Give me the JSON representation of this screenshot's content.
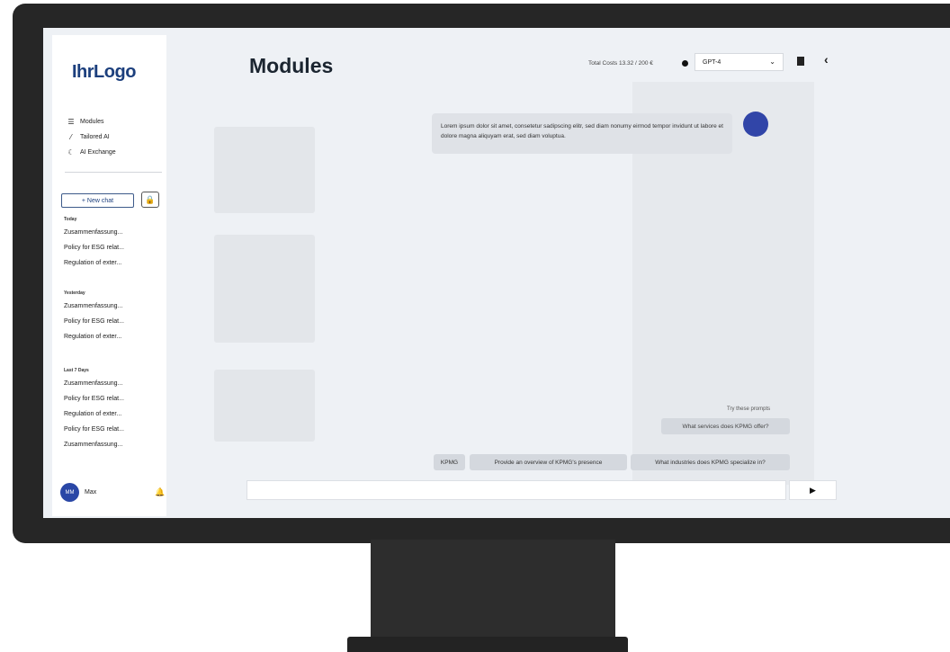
{
  "app": {
    "logo": "IhrLogo",
    "page_title": "Modules"
  },
  "nav": [
    {
      "label": "Modules",
      "icon": "grid-icon"
    },
    {
      "label": "Tailored AI",
      "icon": "wand-icon"
    },
    {
      "label": "AI Exchange",
      "icon": "crescent-icon"
    }
  ],
  "sidebar": {
    "new_chat_label": "+ New chat",
    "lock_icon": "lock-icon",
    "history": [
      {
        "group": "Today",
        "items": [
          "Zusammenfassung...",
          "Policy for ESG relat...",
          "Regulation of exter..."
        ]
      },
      {
        "group": "Yesterday",
        "items": [
          "Zusammenfassung...",
          "Policy for ESG relat...",
          "Regulation of exter..."
        ]
      },
      {
        "group": "Last 7 Days",
        "items": [
          "Zusammenfassung...",
          "Policy for ESG relat...",
          "Regulation of exter...",
          "Policy for ESG relat...",
          "Zusammenfassung..."
        ]
      }
    ],
    "user": {
      "initials": "MM",
      "name": "Max"
    }
  },
  "header": {
    "costs_label": "Total Costs 13.32 / 200 €",
    "model_selected": "GPT-4"
  },
  "chat": {
    "user_message": "Lorem ipsum dolor sit amet, consetetur sadipscing elitr, sed diam nonumy eirmod tempor invidunt ut labore et dolore magna aliquyam erat, sed diam voluptua."
  },
  "suggestions": {
    "hint": "Try these prompts",
    "top": "What services does KPMG offer?",
    "chips": [
      "KPMG",
      "Provide an overview of KPMG's presence",
      "What industries does KPMG specialize in?"
    ]
  },
  "composer": {
    "placeholder": "",
    "send_icon": "play-icon"
  },
  "colors": {
    "brand": "#1c3f7d",
    "accent_avatar": "#3145a8",
    "bezel": "#262626"
  }
}
